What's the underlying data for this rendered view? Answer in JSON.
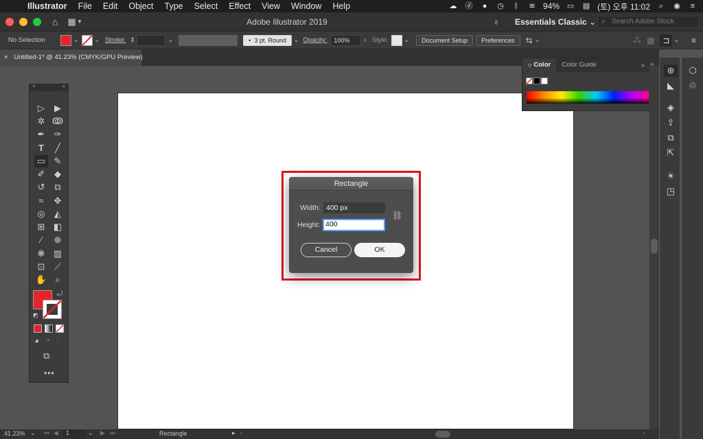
{
  "menubar": {
    "app": "Illustrator",
    "items": [
      "File",
      "Edit",
      "Object",
      "Type",
      "Select",
      "Effect",
      "View",
      "Window",
      "Help"
    ],
    "battery": "94%",
    "clock": "(토) 오후 11:02"
  },
  "window": {
    "title": "Adobe Illustrator 2019",
    "workspace": "Essentials Classic",
    "search_placeholder": "Search Adobe Stock"
  },
  "control_bar": {
    "selection": "No Selection",
    "stroke_label": "Stroke:",
    "brush": "3 pt. Round",
    "opacity_label": "Opacity:",
    "opacity_value": "100%",
    "style_label": "Style:",
    "document_setup": "Document Setup",
    "preferences": "Preferences",
    "fill_color": "#e8232a"
  },
  "document": {
    "tab_title": "Untitled-1* @ 41.23% (CMYK/GPU Preview)"
  },
  "color_panel": {
    "tabs": [
      "Color",
      "Color Guide"
    ]
  },
  "dialog": {
    "title": "Rectangle",
    "width_label": "Width:",
    "width_value": "400 px",
    "height_label": "Height:",
    "height_value": "400",
    "cancel": "Cancel",
    "ok": "OK"
  },
  "status_bar": {
    "zoom": "41.23%",
    "page": "1",
    "tool": "Rectangle"
  }
}
